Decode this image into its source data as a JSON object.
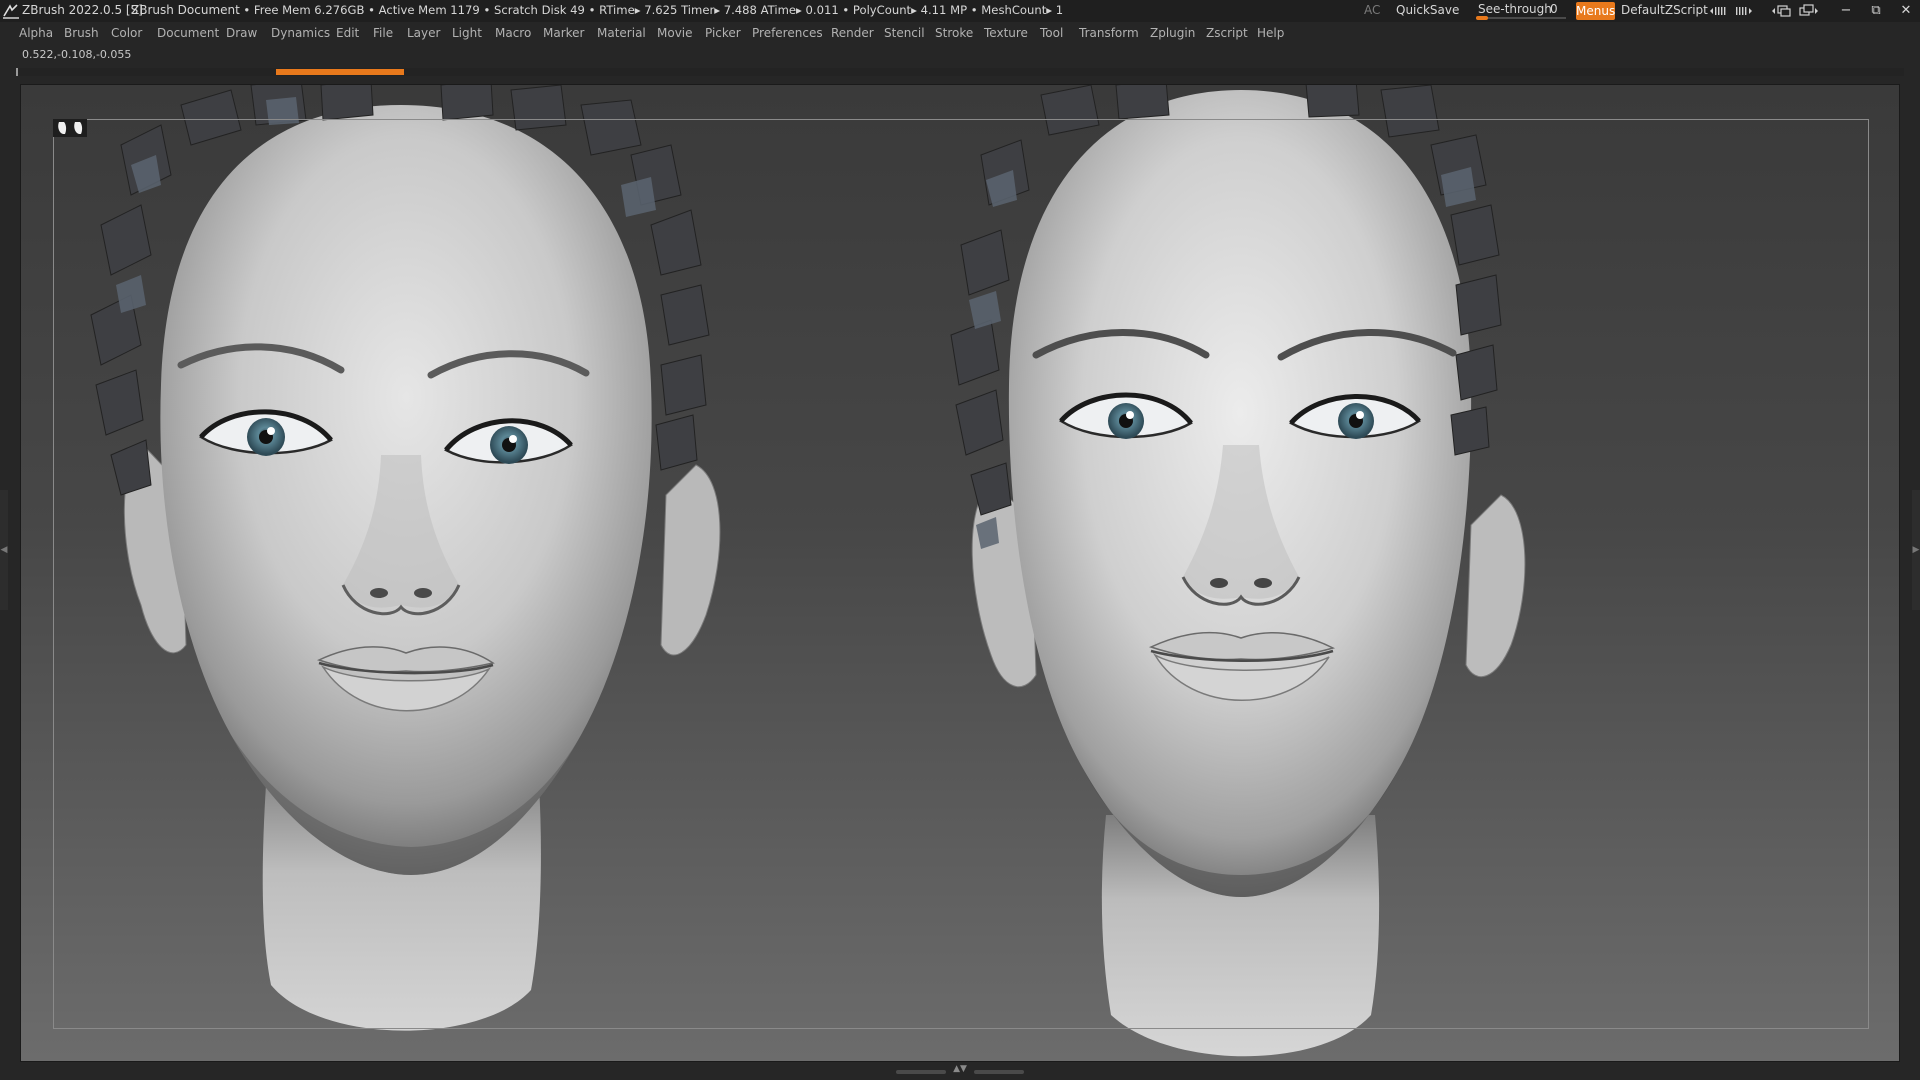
{
  "title_bar": {
    "app_version": "ZBrush 2022.0.5 [S]",
    "document": "ZBrush Document",
    "stats": ". • Free Mem 6.276GB • Active Mem 1179 • Scratch Disk 49 •  RTime▸ 7.625 Timer▸ 7.488 ATime▸ 0.011 • PolyCount▸ 4.11 MP  • MeshCount▸ 1",
    "ac_label": "AC",
    "quicksave_label": "QuickSave",
    "seethrough_label": "See-through",
    "seethrough_value": "0",
    "seethrough_fraction": 0,
    "menus_label": "Menus",
    "script_label": "DefaultZScript",
    "accent_color": "#e8791c"
  },
  "menu": {
    "items": [
      "Alpha",
      "Brush",
      "Color",
      "Document",
      "Draw",
      "Dynamics",
      "Edit",
      "File",
      "Layer",
      "Light",
      "Macro",
      "Marker",
      "Material",
      "Movie",
      "Picker",
      "Preferences",
      "Render",
      "Stencil",
      "Stroke",
      "Texture",
      "Tool",
      "Transform",
      "Zplugin",
      "Zscript",
      "Help"
    ]
  },
  "status": {
    "coordinates": "0.522,-0.108,-0.055"
  },
  "icons": {
    "logo": "zbrush-logo-icon",
    "floor": "floor-grid-icon",
    "minimize": "minimize-icon",
    "restore": "restore-icon",
    "close": "close-icon"
  },
  "window_controls": {
    "minimize": "−",
    "restore": "⧉",
    "close": "✕"
  }
}
